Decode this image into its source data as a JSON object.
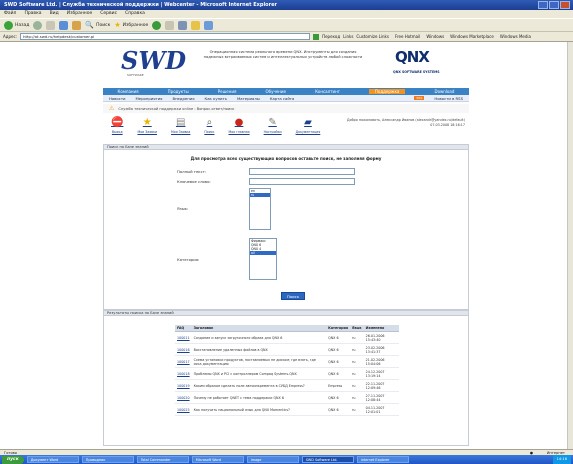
{
  "window": {
    "title": "SWD Software Ltd. | Служба технической поддержки | Webcenter - Microsoft Internet Explorer"
  },
  "menu": [
    "Файл",
    "Правка",
    "Вид",
    "Избранное",
    "Сервис",
    "Справка"
  ],
  "toolbar": {
    "back": "Назад",
    "search": "Поиск",
    "favorites": "Избранное"
  },
  "address": {
    "label": "Адрес:",
    "url": "http://ot.swd.ru/helpdesk/customer.pl",
    "go": "Переход",
    "links_label": "Links",
    "links": [
      "Customize Links",
      "Free Hotmail",
      "Windows",
      "Windows Marketplace",
      "Windows Media"
    ]
  },
  "site": {
    "logo": "SWD",
    "logo_sub": "SOFTWARE",
    "header_text": "Операционная система реального времени QNX. Инструменты для создания надежных встраиваемых систем и интеллектуальных устройств любой сложности",
    "partner_logo": "QNX",
    "partner_sub": "QNX SOFTWARE SYSTEMS",
    "nav1": [
      {
        "label": "Компания",
        "active": false
      },
      {
        "label": "Продукты",
        "active": false
      },
      {
        "label": "Решения",
        "active": false
      },
      {
        "label": "Обучение",
        "active": false
      },
      {
        "label": "Консалтинг",
        "active": false
      },
      {
        "label": "Поддержка",
        "active": true
      },
      {
        "label": "Download",
        "active": false
      }
    ],
    "nav2": [
      "Новости",
      "Мероприятия",
      "Внедрения",
      "Как купить",
      "Материалы",
      "Карта сайта"
    ],
    "rss_badge": "RSS",
    "rss_label": "Новости в RSS",
    "breadcrumb": "Служба технической поддержки online : Вопрос-ответ/поиск",
    "icons": [
      {
        "label": "Выход",
        "glyph": "⛔"
      },
      {
        "label": "Мои Заявки",
        "glyph": "★"
      },
      {
        "label": "Моя Заявка",
        "glyph": "📄"
      },
      {
        "label": "Поиск",
        "glyph": "🔍"
      },
      {
        "label": "Моя главная",
        "glyph": "❓"
      },
      {
        "label": "Настройки",
        "glyph": "🔧"
      },
      {
        "label": "Документация",
        "glyph": "📘"
      }
    ],
    "user_info": "Добро пожаловать, Александр Иванов (alexandr@yandex.ru/default)",
    "user_date": "07.03.2008 18:16:17"
  },
  "search": {
    "section_title": "Поиск по Базе знаний",
    "intro": "Для просмотра всех существующих вопросов оставьте поиск, не заполняя форму",
    "fulltext_label": "Полный текст:",
    "keywords_label": "Ключевое слово:",
    "language_label": "Язык:",
    "languages": [
      "en",
      "ru"
    ],
    "languages_selected": 1,
    "category_label": "Категория:",
    "categories": [
      "Фирмакс",
      "QNX 6",
      "QNX 4",
      "all"
    ],
    "categories_selected": 3,
    "submit": "Поиск"
  },
  "results": {
    "section_title": "Результаты поиска по Базе знаний",
    "columns": [
      "FAQ",
      "Заголовок",
      "Категория",
      "Язык",
      "Изменено"
    ],
    "rows": [
      {
        "id": "100011",
        "title": "Создание и запуск загрузочного образа для QNX 6",
        "category": "QNX 6",
        "lang": "ru",
        "changed": "26.01.2006 15:43:40"
      },
      {
        "id": "100016",
        "title": "Восстановление удаленных файлов в QNX",
        "category": "QNX 6",
        "lang": "ru",
        "changed": "23.02.2006 13:41:37"
      },
      {
        "id": "100017",
        "title": "Схема установки продуктов, поставляемых не диском; где взять, где иска документацию",
        "category": "QNX 6",
        "lang": "ru",
        "changed": "21.02.2006 15:04:06"
      },
      {
        "id": "100018",
        "title": "Проблемы QNX и PCI с контроллером Compaq Systems-QNX",
        "category": "QNX 6",
        "lang": "ru",
        "changed": "24.12.2007 13:19:14"
      },
      {
        "id": "100019",
        "title": "Каким образом сделать поле автоинкремента в СУБД Empress?",
        "category": "Empress",
        "lang": "ru",
        "changed": "22.11.2007 12:09:46"
      },
      {
        "id": "100020",
        "title": "Почему не работает QNET с тема поддержки QNX 6",
        "category": "QNX 6",
        "lang": "ru",
        "changed": "27.11.2007 12:08:44"
      },
      {
        "id": "100025",
        "title": "Как получить национальный язык для QNX Momentics?",
        "category": "QNX 6",
        "lang": "ru",
        "changed": "04.11.2007 12:01:01"
      }
    ]
  },
  "status": {
    "text": "Готово",
    "zone": "Интернет"
  },
  "taskbar": {
    "start": "пуск",
    "tasks": [
      "Документ Word",
      "Проводник",
      "Total Commander",
      "Microsoft Word",
      "Image",
      "SWD Software Ltd.",
      "Internet Explorer"
    ],
    "active_task": 5,
    "clock": "14:16"
  }
}
